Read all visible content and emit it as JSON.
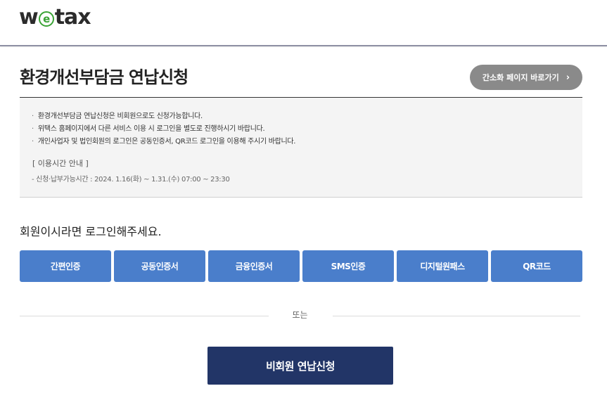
{
  "header": {
    "logo": {
      "w": "w",
      "e": "e",
      "rest": "tax"
    }
  },
  "page": {
    "title": "환경개선부담금 연납신청",
    "quick_link_label": "간소화 페이지 바로가기"
  },
  "notice": {
    "items": [
      "환경개선부담금 연납신청은 비회원으로도 신청가능합니다.",
      "위택스 홈페이지에서 다른 서비스 이용 시 로그인을 별도로 진행하시기 바랍니다.",
      "개인사업자 및 법인회원의 로그인은 공동인증서, QR코드 로그인을 이용해 주시기 바랍니다."
    ],
    "time_heading": "[ 이용시간 안내 ]",
    "time_text": "- 신청·납부가능시간 : 2024. 1.16(화) ~ 1.31.(수) 07:00 ~ 23:30"
  },
  "login": {
    "message": "회원이시라면 로그인해주세요.",
    "methods": [
      "간편인증",
      "공동인증서",
      "금융인증서",
      "SMS인증",
      "디지털원패스",
      "QR코드"
    ]
  },
  "divider_text": "또는",
  "nonmember_button": "비회원 연납신청",
  "colors": {
    "auth_button": "#4a7ecb",
    "nonmember_button": "#223567",
    "quick_link_button": "#8a8a8a",
    "logo_e": "#3aa335"
  }
}
